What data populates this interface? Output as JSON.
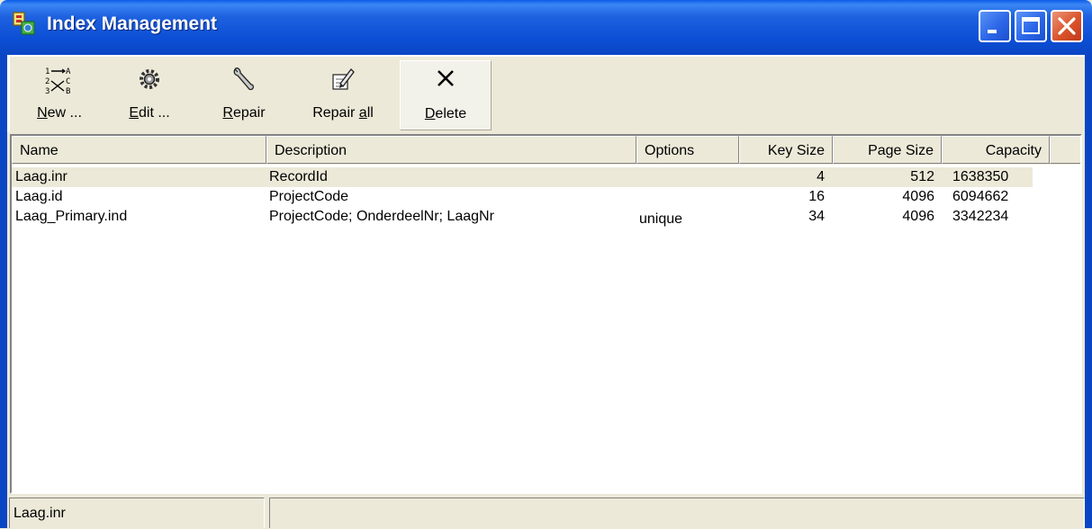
{
  "window": {
    "title": "Index Management",
    "colors": {
      "titlebar": "#0a46c4",
      "face": "#ece9d8",
      "close": "#d9542b"
    }
  },
  "caption_buttons": {
    "minimize_icon": "minimize-icon",
    "maximize_icon": "maximize-icon",
    "close_icon": "close-icon"
  },
  "toolbar": {
    "new": {
      "label_hotkey": "N",
      "label_rest": "ew ...",
      "icon": "sort-numbers-letters-icon"
    },
    "edit": {
      "label_hotkey": "E",
      "label_rest": "dit ...",
      "icon": "gear-icon"
    },
    "repair": {
      "label_hotkey": "R",
      "label_rest": "epair",
      "icon": "wrench-icon"
    },
    "repair_all": {
      "label_prefix": "Repair ",
      "label_hotkey": "a",
      "label_rest": "ll",
      "icon": "pencil-edit-icon"
    },
    "delete": {
      "label_hotkey": "D",
      "label_rest": "elete",
      "icon": "cross-icon"
    }
  },
  "list": {
    "columns": [
      "Name",
      "Description",
      "Options",
      "Key Size",
      "Page Size",
      "Capacity"
    ],
    "rows": [
      {
        "name": "Laag.inr",
        "description": "RecordId",
        "options": "",
        "key_size": "4",
        "page_size": "512",
        "capacity": "1638350",
        "selected": true
      },
      {
        "name": "Laag.id",
        "description": "ProjectCode",
        "options": "",
        "key_size": "16",
        "page_size": "4096",
        "capacity": "6094662",
        "selected": false
      },
      {
        "name": "Laag_Primary.ind",
        "description": "ProjectCode; OnderdeelNr; LaagNr",
        "options": "unique",
        "key_size": "34",
        "page_size": "4096",
        "capacity": "3342234",
        "selected": false
      }
    ]
  },
  "status": {
    "text": "Laag.inr",
    "text2": ""
  }
}
